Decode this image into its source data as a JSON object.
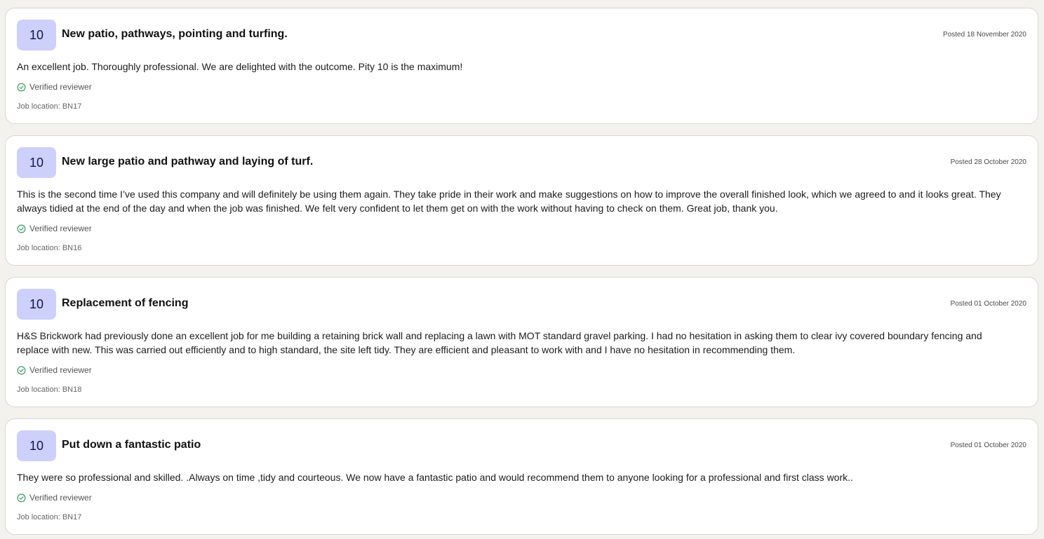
{
  "reviews": [
    {
      "score": "10",
      "title": "New patio, pathways, pointing and turfing.",
      "posted": "Posted 18 November 2020",
      "body": "An excellent job. Thoroughly professional. We are delighted with the outcome. Pity 10 is the maximum!",
      "verified": "Verified reviewer",
      "location": "Job location: BN17"
    },
    {
      "score": "10",
      "title": "New large patio and pathway and laying of turf.",
      "posted": "Posted 28 October 2020",
      "body": "This is the second time I’ve used this company and will definitely be using them again. They take pride in their work and make suggestions on how to improve the overall finished look, which we agreed to and it looks great. They always tidied at the end of the day and when the job was finished. We felt very confident to let them get on with the work without having to check on them. Great job, thank you.",
      "verified": "Verified reviewer",
      "location": "Job location: BN16"
    },
    {
      "score": "10",
      "title": "Replacement of fencing",
      "posted": "Posted 01 October 2020",
      "body": "H&S Brickwork had previously done an excellent job for me building a retaining brick wall and replacing a lawn with MOT standard gravel parking. I had no hesitation in asking them to clear ivy covered boundary fencing and replace with new. This was carried out efficiently and to high standard, the site left tidy. They are efficient and pleasant to work with and I have no hesitation in recommending them.",
      "verified": "Verified reviewer",
      "location": "Job location: BN18"
    },
    {
      "score": "10",
      "title": "Put down a fantastic patio",
      "posted": "Posted 01 October 2020",
      "body": "They were so professional and skilled. .Always on time ,tidy and courteous. We now have a fantastic patio and would recommend them to anyone looking for a professional and first class work..",
      "verified": "Verified reviewer",
      "location": "Job location: BN17"
    }
  ],
  "icons": {
    "verified": "check-circle-icon"
  },
  "colors": {
    "badge_bg": "#cdd0fb",
    "verified_green": "#2f9a5b",
    "page_bg": "#f3f2ee"
  }
}
